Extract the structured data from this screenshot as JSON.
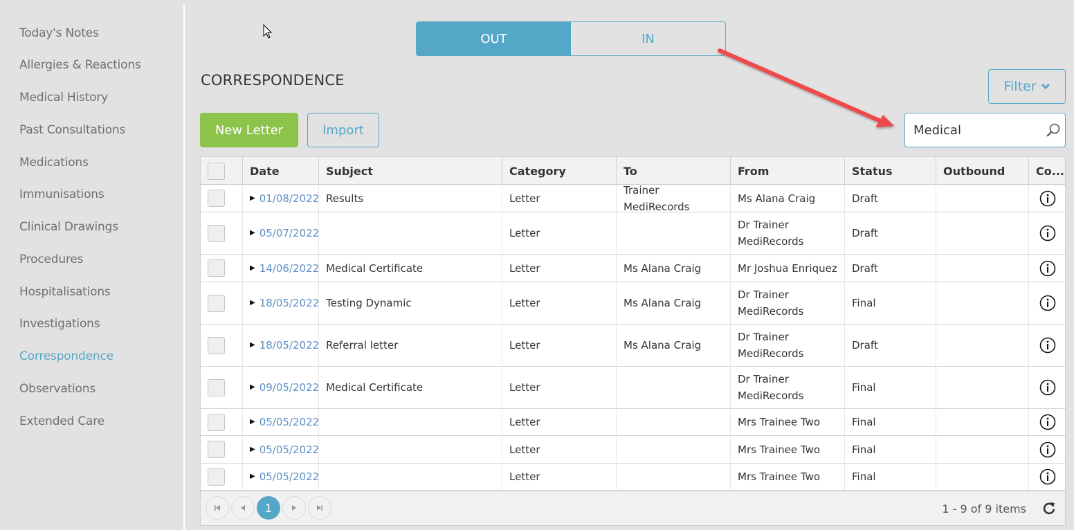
{
  "sidebar": {
    "items": [
      {
        "label": "Today's Notes",
        "active": false
      },
      {
        "label": "Allergies & Reactions",
        "active": false
      },
      {
        "label": "Medical History",
        "active": false
      },
      {
        "label": "Past Consultations",
        "active": false
      },
      {
        "label": "Medications",
        "active": false
      },
      {
        "label": "Immunisations",
        "active": false
      },
      {
        "label": "Clinical Drawings",
        "active": false
      },
      {
        "label": "Procedures",
        "active": false
      },
      {
        "label": "Hospitalisations",
        "active": false
      },
      {
        "label": "Investigations",
        "active": false
      },
      {
        "label": "Correspondence",
        "active": true
      },
      {
        "label": "Observations",
        "active": false
      },
      {
        "label": "Extended Care",
        "active": false
      }
    ]
  },
  "toggle": {
    "out_label": "OUT",
    "in_label": "IN",
    "selected": "OUT"
  },
  "page_title": "CORRESPONDENCE",
  "toolbar": {
    "new_letter_label": "New Letter",
    "import_label": "Import",
    "filter_label": "Filter",
    "search_value": "Medical"
  },
  "grid": {
    "columns": [
      "Date",
      "Subject",
      "Category",
      "To",
      "From",
      "Status",
      "Outbound",
      "Co..."
    ],
    "rows": [
      {
        "date": "01/08/2022",
        "subject": "Results",
        "category": "Letter",
        "to": "Trainer MediRecords",
        "from": "Ms Alana Craig",
        "status": "Draft",
        "outbound": ""
      },
      {
        "date": "05/07/2022",
        "subject": "",
        "category": "Letter",
        "to": "",
        "from": "Dr Trainer MediRecords",
        "status": "Draft",
        "outbound": ""
      },
      {
        "date": "14/06/2022",
        "subject": "Medical Certificate",
        "category": "Letter",
        "to": "Ms Alana Craig",
        "from": "Mr Joshua Enriquez",
        "status": "Draft",
        "outbound": ""
      },
      {
        "date": "18/05/2022",
        "subject": "Testing Dynamic",
        "category": "Letter",
        "to": "Ms Alana Craig",
        "from": "Dr Trainer MediRecords",
        "status": "Final",
        "outbound": ""
      },
      {
        "date": "18/05/2022",
        "subject": "Referral letter",
        "category": "Letter",
        "to": "Ms Alana Craig",
        "from": "Dr Trainer MediRecords",
        "status": "Draft",
        "outbound": ""
      },
      {
        "date": "09/05/2022",
        "subject": "Medical Certificate",
        "category": "Letter",
        "to": "",
        "from": "Dr Trainer MediRecords",
        "status": "Final",
        "outbound": ""
      },
      {
        "date": "05/05/2022",
        "subject": "",
        "category": "Letter",
        "to": "",
        "from": "Mrs Trainee Two",
        "status": "Final",
        "outbound": ""
      },
      {
        "date": "05/05/2022",
        "subject": "",
        "category": "Letter",
        "to": "",
        "from": "Mrs Trainee Two",
        "status": "Final",
        "outbound": ""
      },
      {
        "date": "05/05/2022",
        "subject": "",
        "category": "Letter",
        "to": "",
        "from": "Mrs Trainee Two",
        "status": "Final",
        "outbound": ""
      }
    ]
  },
  "pager": {
    "current_page": "1",
    "summary": "1 - 9 of 9 items"
  },
  "colors": {
    "accent": "#55a7c8",
    "primary_button": "#8cc34a",
    "annotation_arrow": "#f04a4a"
  }
}
